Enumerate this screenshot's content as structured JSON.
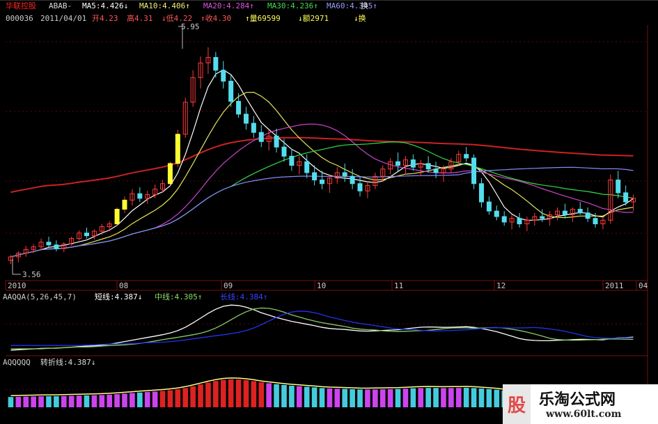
{
  "header": {
    "stock_name": "华联控股",
    "formula": "ABAB-",
    "ma5": "MA5:4.426↓",
    "ma10": "MA10:4.406↑",
    "ma20": "MA20:4.284↑",
    "ma30": "MA30:4.236↑",
    "ma60": "MA60:4.345↑",
    "tail": "换"
  },
  "info": {
    "code": "000036",
    "date": "2011/04/01",
    "open": "开4.23",
    "high": "高4.31",
    "low": "↓低4.22",
    "close": "↑收4.30",
    "volume": "↑量69599",
    "amount": "↓额2971",
    "tail": "↓换"
  },
  "annotations": {
    "high_mark": "5.95",
    "low_mark": "3.56"
  },
  "indicator1": {
    "title": "AAQQA(5,26,45,7)",
    "short": "短线:4.387↓",
    "mid": "中线:4.305↑",
    "long": "长线:4.384↑"
  },
  "indicator2": {
    "title": "AQQQQQ",
    "turn": "转折线:4.387↓"
  },
  "watermark": {
    "badge": "股",
    "title": "乐淘公式网",
    "url": "www.60lt.com"
  },
  "colors": {
    "up": "#ff3b3b",
    "down": "#55ddee",
    "volume_bar": "#ffff33",
    "ma5": "#ffffff",
    "ma10": "#e8e85a",
    "ma20": "#cc44cc",
    "ma30": "#33dd44",
    "ma60": "#8888ff",
    "long_ma": "#cc2222",
    "grid": "#7a1010",
    "ind_blue": "#2233ee",
    "ind_green": "#88cc66",
    "ind_white": "#ffffff",
    "hist_red": "#dd2222",
    "hist_cyan": "#44ccdd",
    "hist_magenta": "#cc44ee",
    "hist_line": "#ffff88"
  },
  "chart_data": [
    {
      "type": "candlestick",
      "x_ticks": [
        "2010",
        "08",
        "09",
        "10",
        "11",
        "12",
        "2011",
        "04"
      ],
      "ylim": [
        3.56,
        5.95
      ],
      "annotations": [
        "5.95",
        "3.56"
      ],
      "series": [
        {
          "name": "MA5",
          "value": 4.426
        },
        {
          "name": "MA10",
          "value": 4.406
        },
        {
          "name": "MA20",
          "value": 4.284
        },
        {
          "name": "MA30",
          "value": 4.236
        },
        {
          "name": "MA60",
          "value": 4.345
        }
      ],
      "ohlc": [
        [
          3.62,
          3.68,
          3.58,
          3.66
        ],
        [
          3.66,
          3.72,
          3.6,
          3.7
        ],
        [
          3.7,
          3.78,
          3.66,
          3.74
        ],
        [
          3.74,
          3.8,
          3.7,
          3.77
        ],
        [
          3.77,
          3.86,
          3.74,
          3.82
        ],
        [
          3.82,
          3.88,
          3.76,
          3.79
        ],
        [
          3.79,
          3.84,
          3.72,
          3.75
        ],
        [
          3.75,
          3.82,
          3.71,
          3.8
        ],
        [
          3.8,
          3.88,
          3.78,
          3.86
        ],
        [
          3.86,
          3.95,
          3.84,
          3.92
        ],
        [
          3.92,
          3.98,
          3.86,
          3.89
        ],
        [
          3.89,
          3.96,
          3.85,
          3.94
        ],
        [
          3.94,
          4.02,
          3.9,
          3.99
        ],
        [
          3.99,
          4.05,
          3.94,
          4.02
        ],
        [
          4.02,
          4.2,
          4.0,
          4.18
        ],
        [
          4.18,
          4.32,
          4.14,
          4.28
        ],
        [
          4.28,
          4.4,
          4.22,
          4.35
        ],
        [
          4.35,
          4.42,
          4.26,
          4.3
        ],
        [
          4.3,
          4.38,
          4.24,
          4.34
        ],
        [
          4.34,
          4.45,
          4.3,
          4.4
        ],
        [
          4.4,
          4.5,
          4.36,
          4.46
        ],
        [
          4.46,
          4.7,
          4.44,
          4.68
        ],
        [
          4.68,
          5.05,
          4.64,
          5.0
        ],
        [
          5.0,
          5.4,
          4.96,
          5.35
        ],
        [
          5.35,
          5.7,
          5.3,
          5.62
        ],
        [
          5.62,
          5.85,
          5.5,
          5.78
        ],
        [
          5.78,
          5.95,
          5.66,
          5.84
        ],
        [
          5.84,
          5.9,
          5.62,
          5.7
        ],
        [
          5.7,
          5.8,
          5.5,
          5.58
        ],
        [
          5.58,
          5.66,
          5.3,
          5.36
        ],
        [
          5.36,
          5.45,
          5.18,
          5.22
        ],
        [
          5.22,
          5.3,
          5.05,
          5.12
        ],
        [
          5.12,
          5.2,
          4.96,
          5.02
        ],
        [
          5.02,
          5.1,
          4.86,
          4.92
        ],
        [
          4.92,
          5.05,
          4.82,
          4.98
        ],
        [
          4.98,
          5.06,
          4.8,
          4.86
        ],
        [
          4.86,
          4.95,
          4.7,
          4.76
        ],
        [
          4.76,
          4.84,
          4.6,
          4.66
        ],
        [
          4.66,
          4.76,
          4.56,
          4.7
        ],
        [
          4.7,
          4.78,
          4.52,
          4.58
        ],
        [
          4.58,
          4.66,
          4.44,
          4.5
        ],
        [
          4.5,
          4.6,
          4.4,
          4.46
        ],
        [
          4.46,
          4.56,
          4.36,
          4.52
        ],
        [
          4.52,
          4.64,
          4.46,
          4.58
        ],
        [
          4.58,
          4.68,
          4.48,
          4.54
        ],
        [
          4.54,
          4.62,
          4.4,
          4.46
        ],
        [
          4.46,
          4.54,
          4.32,
          4.38
        ],
        [
          4.38,
          4.48,
          4.3,
          4.44
        ],
        [
          4.44,
          4.58,
          4.4,
          4.54
        ],
        [
          4.54,
          4.66,
          4.48,
          4.62
        ],
        [
          4.62,
          4.74,
          4.56,
          4.7
        ],
        [
          4.7,
          4.8,
          4.6,
          4.66
        ],
        [
          4.66,
          4.76,
          4.56,
          4.72
        ],
        [
          4.72,
          4.78,
          4.6,
          4.64
        ],
        [
          4.64,
          4.72,
          4.54,
          4.68
        ],
        [
          4.68,
          4.76,
          4.58,
          4.62
        ],
        [
          4.62,
          4.7,
          4.52,
          4.58
        ],
        [
          4.58,
          4.66,
          4.48,
          4.62
        ],
        [
          4.62,
          4.74,
          4.58,
          4.7
        ],
        [
          4.7,
          4.82,
          4.66,
          4.78
        ],
        [
          4.78,
          4.86,
          4.7,
          4.74
        ],
        [
          4.74,
          4.78,
          4.4,
          4.46
        ],
        [
          4.46,
          4.52,
          4.2,
          4.26
        ],
        [
          4.26,
          4.32,
          4.12,
          4.16
        ],
        [
          4.16,
          4.22,
          4.06,
          4.1
        ],
        [
          4.1,
          4.16,
          4.0,
          4.04
        ],
        [
          4.04,
          4.12,
          3.96,
          4.08
        ],
        [
          4.08,
          4.14,
          3.98,
          4.02
        ],
        [
          4.02,
          4.1,
          3.94,
          4.06
        ],
        [
          4.06,
          4.14,
          4.0,
          4.1
        ],
        [
          4.1,
          4.18,
          4.04,
          4.08
        ],
        [
          4.08,
          4.16,
          4.0,
          4.12
        ],
        [
          4.12,
          4.2,
          4.06,
          4.16
        ],
        [
          4.16,
          4.24,
          4.08,
          4.12
        ],
        [
          4.12,
          4.2,
          4.04,
          4.18
        ],
        [
          4.18,
          4.26,
          4.12,
          4.14
        ],
        [
          4.14,
          4.2,
          4.04,
          4.08
        ],
        [
          4.08,
          4.14,
          3.98,
          4.02
        ],
        [
          4.02,
          4.1,
          3.96,
          4.06
        ],
        [
          4.06,
          4.56,
          4.02,
          4.5
        ],
        [
          4.5,
          4.6,
          4.3,
          4.36
        ],
        [
          4.36,
          4.44,
          4.22,
          4.26
        ],
        [
          4.26,
          4.34,
          4.16,
          4.3
        ]
      ]
    },
    {
      "type": "line",
      "title": "AAQQA(5,26,45,7)",
      "series": [
        {
          "name": "短线",
          "value": 4.387
        },
        {
          "name": "中线",
          "value": 4.305
        },
        {
          "name": "长线",
          "value": 4.384
        }
      ]
    },
    {
      "type": "bar",
      "title": "AQQQQQ",
      "series": [
        {
          "name": "转折线",
          "value": 4.387
        }
      ]
    }
  ]
}
